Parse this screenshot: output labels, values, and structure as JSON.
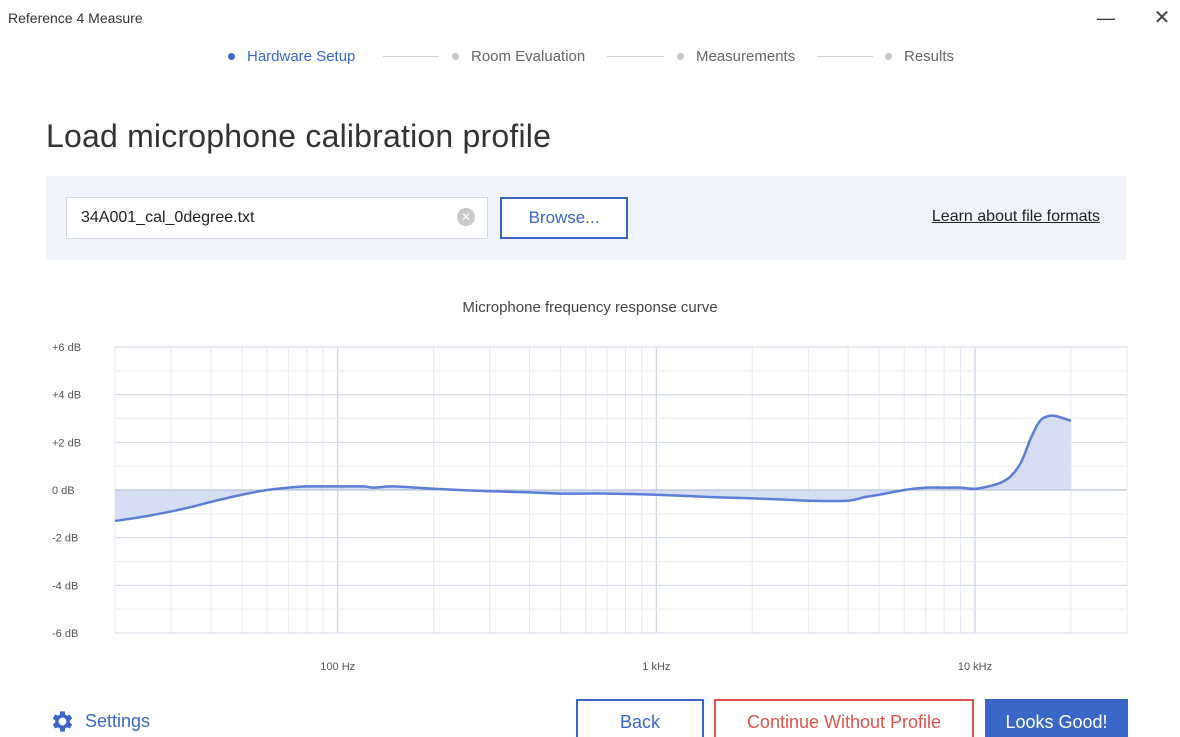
{
  "window": {
    "title": "Reference 4 Measure",
    "minimize_glyph": "—",
    "close_glyph": "✕"
  },
  "stepper": {
    "steps": [
      {
        "label": "Hardware Setup",
        "active": true
      },
      {
        "label": "Room Evaluation",
        "active": false
      },
      {
        "label": "Measurements",
        "active": false
      },
      {
        "label": "Results",
        "active": false
      }
    ]
  },
  "page_title": "Load microphone calibration profile",
  "file_panel": {
    "file_value": "34A001_cal_0degree.txt",
    "clear_icon": "clear-icon",
    "browse_label": "Browse...",
    "learn_link": "Learn about file formats"
  },
  "chart_title": "Microphone frequency response curve",
  "chart_data": {
    "type": "area",
    "title": "Microphone frequency response curve",
    "x_scale": "log",
    "xlim": [
      20,
      30000
    ],
    "ylim": [
      -6,
      6
    ],
    "y_ticks": [
      6,
      4,
      2,
      0,
      -2,
      -4,
      -6
    ],
    "y_tick_labels": [
      "+6 dB",
      "+4 dB",
      "+2 dB",
      "0 dB",
      "-2 dB",
      "-4 dB",
      "-6 dB"
    ],
    "x_ticks": [
      100,
      1000,
      10000
    ],
    "x_tick_labels": [
      "100 Hz",
      "1 kHz",
      "10 kHz"
    ],
    "grid": true,
    "color": "#5b7fd6",
    "fill_color": "#d6def3",
    "series": [
      {
        "x": [
          20,
          25,
          30,
          35,
          40,
          50,
          60,
          70,
          80,
          90,
          100,
          120,
          130,
          150,
          200,
          300,
          400,
          500,
          700,
          1000,
          1500,
          2000,
          2500,
          3000,
          4000,
          4500,
          5000,
          6000,
          7000,
          8000,
          9000,
          10000,
          11000,
          12000,
          13000,
          14000,
          15000,
          16000,
          17000,
          18000,
          20000
        ],
        "y": [
          -1.3,
          -1.1,
          -0.9,
          -0.7,
          -0.5,
          -0.2,
          0.0,
          0.1,
          0.15,
          0.15,
          0.15,
          0.15,
          0.1,
          0.15,
          0.05,
          -0.05,
          -0.1,
          -0.15,
          -0.15,
          -0.2,
          -0.3,
          -0.35,
          -0.4,
          -0.45,
          -0.45,
          -0.3,
          -0.2,
          0.0,
          0.1,
          0.1,
          0.1,
          0.05,
          0.15,
          0.3,
          0.6,
          1.2,
          2.2,
          2.9,
          3.1,
          3.1,
          2.9
        ]
      }
    ]
  },
  "settings": {
    "label": "Settings",
    "icon": "gear-icon"
  },
  "buttons": {
    "back": "Back",
    "continue": "Continue Without Profile",
    "looks_good": "Looks Good!"
  },
  "colors": {
    "accent": "#3a67c7",
    "danger": "#e0524c",
    "panel_bg": "#f1f5fb"
  }
}
